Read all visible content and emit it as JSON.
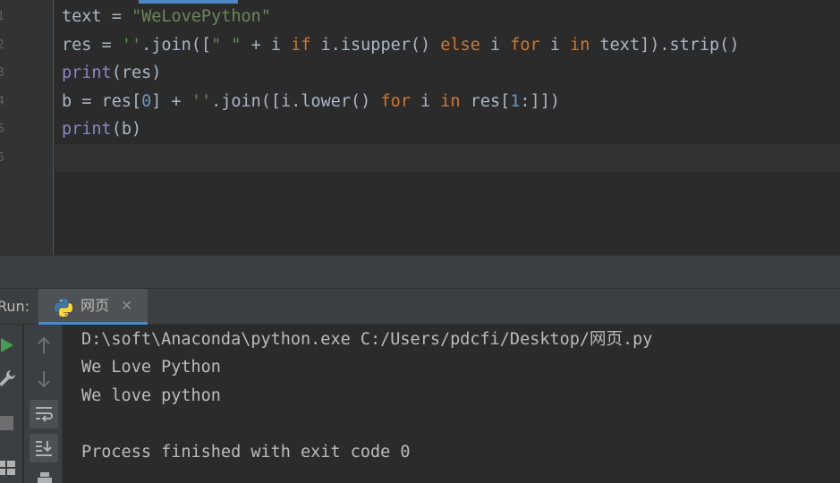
{
  "editor": {
    "line_numbers": [
      "1",
      "2",
      "3",
      "4",
      "5",
      "6"
    ],
    "lines": [
      [
        {
          "t": "text = ",
          "c": "plain"
        },
        {
          "t": "\"WeLovePython\"",
          "c": "str"
        }
      ],
      [
        {
          "t": "res = ",
          "c": "plain"
        },
        {
          "t": "''",
          "c": "str"
        },
        {
          "t": ".join([",
          "c": "plain"
        },
        {
          "t": "\" \"",
          "c": "str"
        },
        {
          "t": " + i ",
          "c": "plain"
        },
        {
          "t": "if",
          "c": "kw"
        },
        {
          "t": " i.isupper() ",
          "c": "plain"
        },
        {
          "t": "else",
          "c": "kw"
        },
        {
          "t": " i ",
          "c": "plain"
        },
        {
          "t": "for",
          "c": "kw"
        },
        {
          "t": " i ",
          "c": "plain"
        },
        {
          "t": "in",
          "c": "kw"
        },
        {
          "t": " text]).strip()",
          "c": "plain"
        }
      ],
      [
        {
          "t": "print",
          "c": "bi"
        },
        {
          "t": "(res)",
          "c": "plain"
        }
      ],
      [
        {
          "t": "b = res[",
          "c": "plain"
        },
        {
          "t": "0",
          "c": "num"
        },
        {
          "t": "] + ",
          "c": "plain"
        },
        {
          "t": "''",
          "c": "str"
        },
        {
          "t": ".join([i.lower() ",
          "c": "plain"
        },
        {
          "t": "for",
          "c": "kw"
        },
        {
          "t": " i ",
          "c": "plain"
        },
        {
          "t": "in",
          "c": "kw"
        },
        {
          "t": " res[",
          "c": "plain"
        },
        {
          "t": "1",
          "c": "num"
        },
        {
          "t": ":]])",
          "c": "plain"
        }
      ],
      [
        {
          "t": "print",
          "c": "bi"
        },
        {
          "t": "(b)",
          "c": "plain"
        }
      ],
      []
    ]
  },
  "run_panel": {
    "label": "Run:",
    "tab_title": "网页",
    "close_glyph": "✕",
    "output_lines": [
      "D:\\soft\\Anaconda\\python.exe C:/Users/pdcfi/Desktop/网页.py",
      "We Love Python",
      "We love python",
      "",
      "Process finished with exit code 0"
    ]
  },
  "icons": {
    "toolbar_left": [
      "rerun-icon",
      "wrench-icon",
      "stop-icon",
      "layout-icon"
    ],
    "toolbar_second": [
      "scroll-up-icon",
      "scroll-down-icon",
      "soft-wrap-icon",
      "scroll-to-end-icon",
      "print-icon"
    ]
  },
  "colors": {
    "keyword": "#cc7832",
    "string": "#6a8759",
    "number": "#6897bb",
    "builtin": "#8888c6",
    "text": "#a9b7c6",
    "accent": "#4a88c7",
    "run_green": "#499c54"
  }
}
